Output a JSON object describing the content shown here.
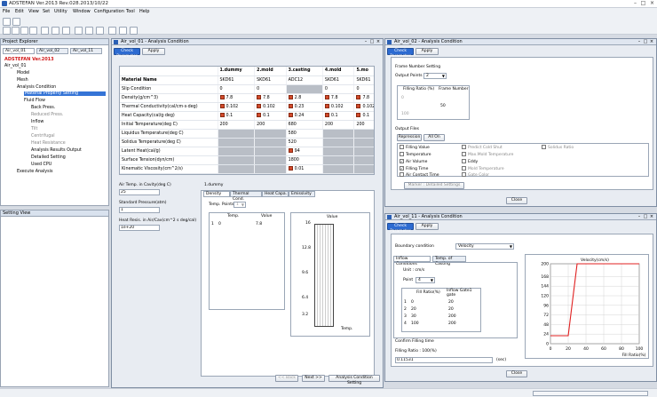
{
  "app": {
    "title": "ADSTEFAN Ver.2013 Rev.028.2013/10/22"
  },
  "menu": [
    "File",
    "Edit",
    "View",
    "Set",
    "Utility",
    "Window",
    "Configuration",
    "Tool",
    "Help"
  ],
  "explorer": {
    "title": "Project Explorer",
    "tabs": [
      "Air_vol_01",
      "Air_vol_02",
      "Air_vol_11"
    ],
    "version": "ADSTEFAN Ver.2013",
    "tree": [
      "Air_vol_01",
      "Model",
      "Mesh",
      "Analysis Condition",
      "Material Property Setting",
      "Fluid Flow",
      "Back Press.",
      "Reduced Press.",
      "Inflow",
      "Tilt",
      "Centrifugal",
      "Heat Resistance",
      "Analysis Results Output",
      "Detailed Setting",
      "Used CPU",
      "Execute Analysis"
    ]
  },
  "setting_view": {
    "title": "Setting View"
  },
  "win1": {
    "title": "Air_vol_01 - Analysis Condition",
    "check": "Check Parameter",
    "apply": "Apply",
    "headers": [
      "Material Name",
      "1.dummy",
      "2.mold",
      "3.casting",
      "4.mold",
      "5.mo"
    ],
    "rows": [
      [
        "Material Name",
        "SKD61",
        "SKD61",
        "ADC12",
        "SKD61",
        "SKD61"
      ],
      [
        "Slip Condition",
        "0",
        "0",
        "",
        "0",
        "0"
      ],
      [
        "Density(g/cm^3)",
        "7.8",
        "7.8",
        "2.8",
        "7.8",
        "7.8"
      ],
      [
        "Thermal Conductivity(cal/cm·s·deg)",
        "0.102",
        "0.102",
        "0.23",
        "0.102",
        "0.102"
      ],
      [
        "Heat Capacity(cal/g·deg)",
        "0.1",
        "0.1",
        "0.24",
        "0.1",
        "0.1"
      ],
      [
        "Initial Temperature(deg C)",
        "200",
        "200",
        "680",
        "200",
        "200"
      ],
      [
        "Liquidus Temperature(deg C)",
        "",
        "",
        "580",
        "",
        ""
      ],
      [
        "Solidus Temperature(deg C)",
        "",
        "",
        "520",
        "",
        ""
      ],
      [
        "Latent Heat(cal/g)",
        "",
        "",
        "94",
        "",
        ""
      ],
      [
        "Surface Tension(dyn/cm)",
        "",
        "",
        "1800",
        "",
        ""
      ],
      [
        "Kinematic Viscosity(cm^2/s)",
        "",
        "",
        "0.01",
        "",
        ""
      ]
    ],
    "air_temp_label": "Air Temp. in Cavity(deg C)",
    "air_temp": "25",
    "std_press_label": "Standard Pressure(atm)",
    "std_press": "1",
    "heat_resis_label": "Heat Resis. in Air/Cav(cm^2 s deg/cal)",
    "heat_resis": "1e+20",
    "sub_title": "1.dummy",
    "sub_tabs": [
      "Density",
      "Thermal Cond.",
      "Heat Capa.",
      "Emissivity"
    ],
    "temp_points_label": "Temp. Points",
    "temp_points": "1",
    "tbl_headers": [
      "Temp.",
      "Value"
    ],
    "tbl_row": [
      "1",
      "0",
      "7.8"
    ],
    "chart_title": "Value",
    "chart_xlabel": "Temp.",
    "back": "<< Back",
    "next": "Next >>",
    "analysis_btn": "Analysis Condition Setting"
  },
  "win2": {
    "title": "Air_vol_02 - Analysis Condition",
    "check": "Check Parameter",
    "apply": "Apply",
    "frame_label": "Frame Number Setting",
    "output_points_label": "Output Points",
    "output_points": "2",
    "headers": [
      "Filling Ratio (%)",
      "Frame Number"
    ],
    "rows": [
      [
        "0",
        ""
      ],
      [
        "",
        "50"
      ],
      [
        "100",
        ""
      ]
    ],
    "output_files": "Output Files",
    "repression": "Repression",
    "all_on": "All On",
    "checks": [
      [
        "Filling Value",
        false
      ],
      [
        "Predict Cold Shut",
        false
      ],
      [
        "Solidus Ratio",
        false
      ],
      [
        "Temperature",
        false
      ],
      [
        "Max.Mold Temperature",
        false
      ],
      [
        "Air Volume",
        true
      ],
      [
        "Eddy",
        false
      ],
      [
        "Filling Time",
        true
      ],
      [
        "Mold Temperature",
        false
      ],
      [
        "Air Contact Time",
        false
      ],
      [
        "Gate Color",
        false
      ]
    ],
    "marker": "Marker : Detailed Settings",
    "close": "Close"
  },
  "win3": {
    "title": "Air_vol_11 - Analysis Condition",
    "check": "Check Parameter",
    "apply": "Apply",
    "boundary_label": "Boundary condition",
    "boundary": "Velocity",
    "tabs": [
      "Inflow Conditions",
      "Temp. of Casting"
    ],
    "unit": "Unit : cm/s",
    "point_label": "Point",
    "point": "4",
    "headers": [
      "Fill Ratio(%)",
      "Inflow Gate1 gate"
    ],
    "rows": [
      [
        "1",
        "0",
        "20"
      ],
      [
        "2",
        "20",
        "20"
      ],
      [
        "3",
        "30",
        "200"
      ],
      [
        "4",
        "100",
        "200"
      ]
    ],
    "confirm": "Confirm Filling time",
    "fill_ratio": "Filling Ratio : 100(%)",
    "fill_time": "0.11531",
    "sec": "(sec)",
    "close": "Close"
  },
  "chart_data": {
    "type": "line",
    "title": "Velocity(cm/s)",
    "xlabel": "Fill Ratio(%)",
    "ylabel": "",
    "x": [
      0,
      20,
      30,
      100
    ],
    "series": [
      {
        "values": [
          20,
          20,
          200,
          200
        ]
      }
    ],
    "xlim": [
      0,
      100
    ],
    "ylim": [
      0,
      200
    ],
    "xticks": [
      0,
      20,
      40,
      60,
      80,
      100
    ],
    "yticks": [
      0,
      24,
      48,
      72,
      96,
      120,
      144,
      168,
      200
    ]
  }
}
